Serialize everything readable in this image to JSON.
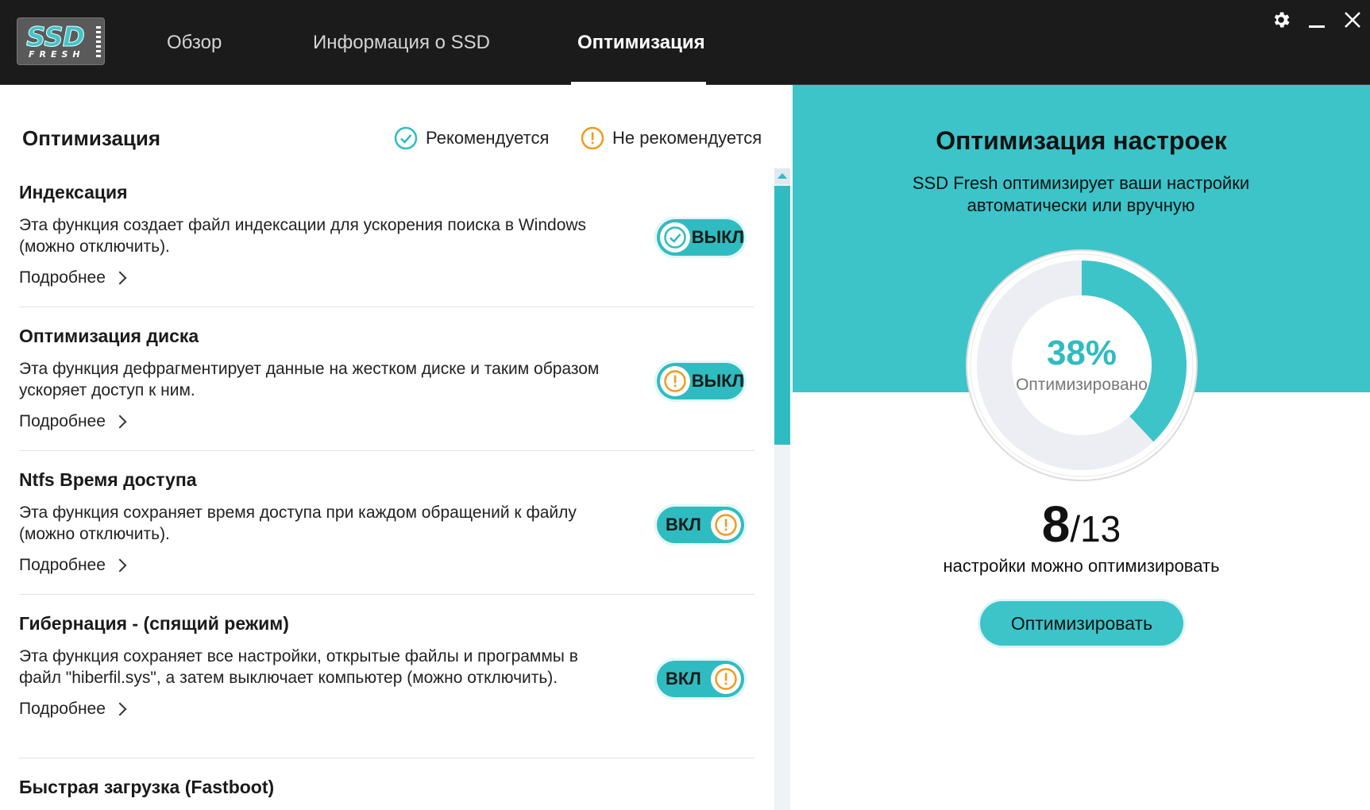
{
  "app": {
    "logo_main": "SSD",
    "logo_sub": "FRESH",
    "accent_color": "#3cc4c9",
    "warning_color": "#f29a1f"
  },
  "tabs": [
    {
      "label": "Обзор",
      "active": false
    },
    {
      "label": "Информация о SSD",
      "active": false
    },
    {
      "label": "Оптимизация",
      "active": true
    }
  ],
  "window": {
    "settings_icon": "gear-icon",
    "minimize_icon": "minimize-icon",
    "close_icon": "close-icon"
  },
  "left": {
    "title": "Оптимизация",
    "legend": {
      "recommended": "Рекомендуется",
      "not_recommended": "Не рекомендуется"
    },
    "more_label": "Подробнее",
    "items": [
      {
        "title": "Индексация",
        "desc": "Эта функция создает файл индексации для ускорения поиска в Windows (можно отключить).",
        "more": "Подробнее",
        "toggle_label": "ВЫКЛ",
        "state": "off",
        "status": "recommended"
      },
      {
        "title": "Оптимизация диска",
        "desc": "Эта функция дефрагментирует данные на жестком диске и таким образом ускоряет доступ к ним.",
        "more": "Подробнее",
        "toggle_label": "ВЫКЛ",
        "state": "off",
        "status": "not_recommended"
      },
      {
        "title": "Ntfs Время доступа",
        "desc": "Эта функция сохраняет время доступа при каждом обращений к файлу (можно отключить).",
        "more": "Подробнее",
        "toggle_label": "ВКЛ",
        "state": "on",
        "status": "not_recommended"
      },
      {
        "title": "Гибернация - (спящий режим)",
        "desc": "Эта функция сохраняет все настройки, открытые файлы и программы в файл \"hiberfil.sys\", а затем выключает компьютер (можно отключить).",
        "more": "Подробнее",
        "toggle_label": "ВКЛ",
        "state": "on",
        "status": "not_recommended"
      },
      {
        "title": "Быстрая загрузка (Fastboot)"
      }
    ]
  },
  "right": {
    "title": "Оптимизация настроек",
    "subtitle": "SSD Fresh оптимизирует ваши настройки автоматически или вручную",
    "percent_text": "38%",
    "percent_value": 0.38,
    "percent_label": "Оптимизировано",
    "count_current": "8",
    "count_total": "/13",
    "count_label": "настройки можно оптимизировать",
    "button_label": "Оптимизировать"
  }
}
